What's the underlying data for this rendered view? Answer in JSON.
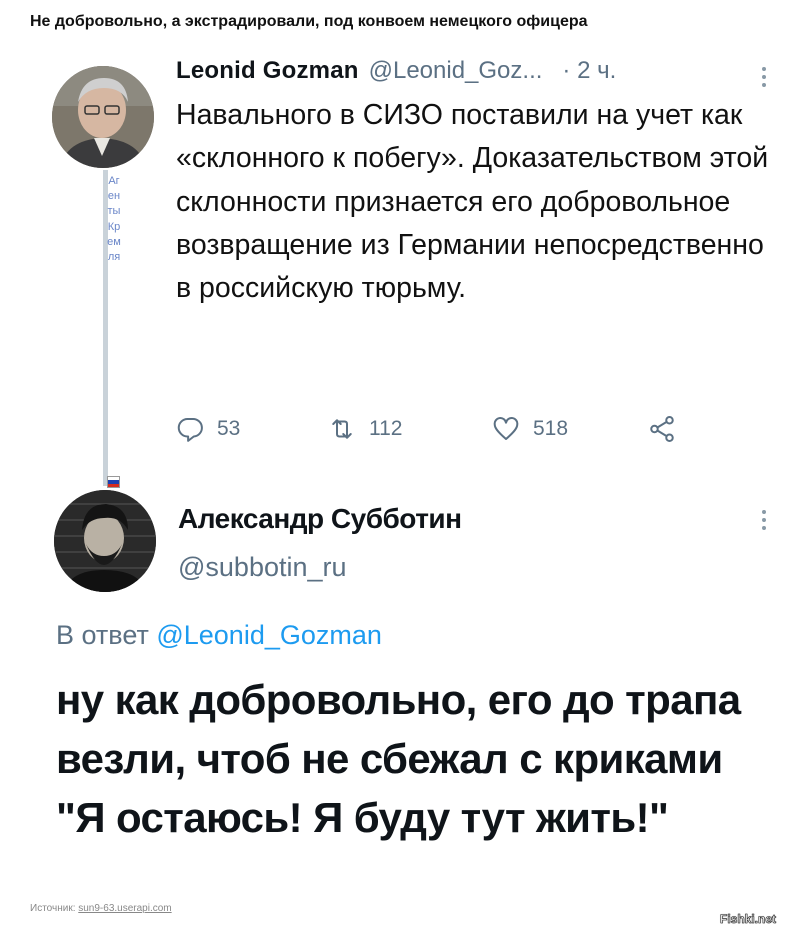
{
  "page_title": "Не добровольно, а экстрадировали, под конвоем немецкого офицера",
  "tweet1": {
    "name": "Leonid Gozman",
    "handle": "@Leonid_Goz...",
    "time": "· 2 ч.",
    "text": "Навального в СИЗО поставили на учет как «склонного к побегу». Доказательством этой склонности признается его добровольное возвращение из Германии непосредственно в российскую тюрьму.",
    "replies": "53",
    "retweets": "112",
    "likes": "518"
  },
  "thread_caption": "Агенты Кремля",
  "flag_colors": [
    "#ffffff",
    "#1c3fb0",
    "#d52b1e"
  ],
  "tweet2": {
    "name": "Александр Субботин",
    "handle": "@subbotin_ru",
    "reply_prefix": "В ответ",
    "reply_mention": "@Leonid_Gozman",
    "text": "ну как добровольно, его до трапа везли, чтоб не сбежал с криками \"Я остаюсь! Я буду тут жить!\""
  },
  "source": {
    "label": "Источник:",
    "link": "sun9-63.userapi.com"
  },
  "watermark": "Fishki.net",
  "icons": [
    "reply-icon",
    "retweet-icon",
    "like-icon",
    "share-icon",
    "more-icon"
  ],
  "colors": {
    "handle": "#5b7083",
    "mention": "#1d9bf0",
    "text": "#0f1419"
  }
}
